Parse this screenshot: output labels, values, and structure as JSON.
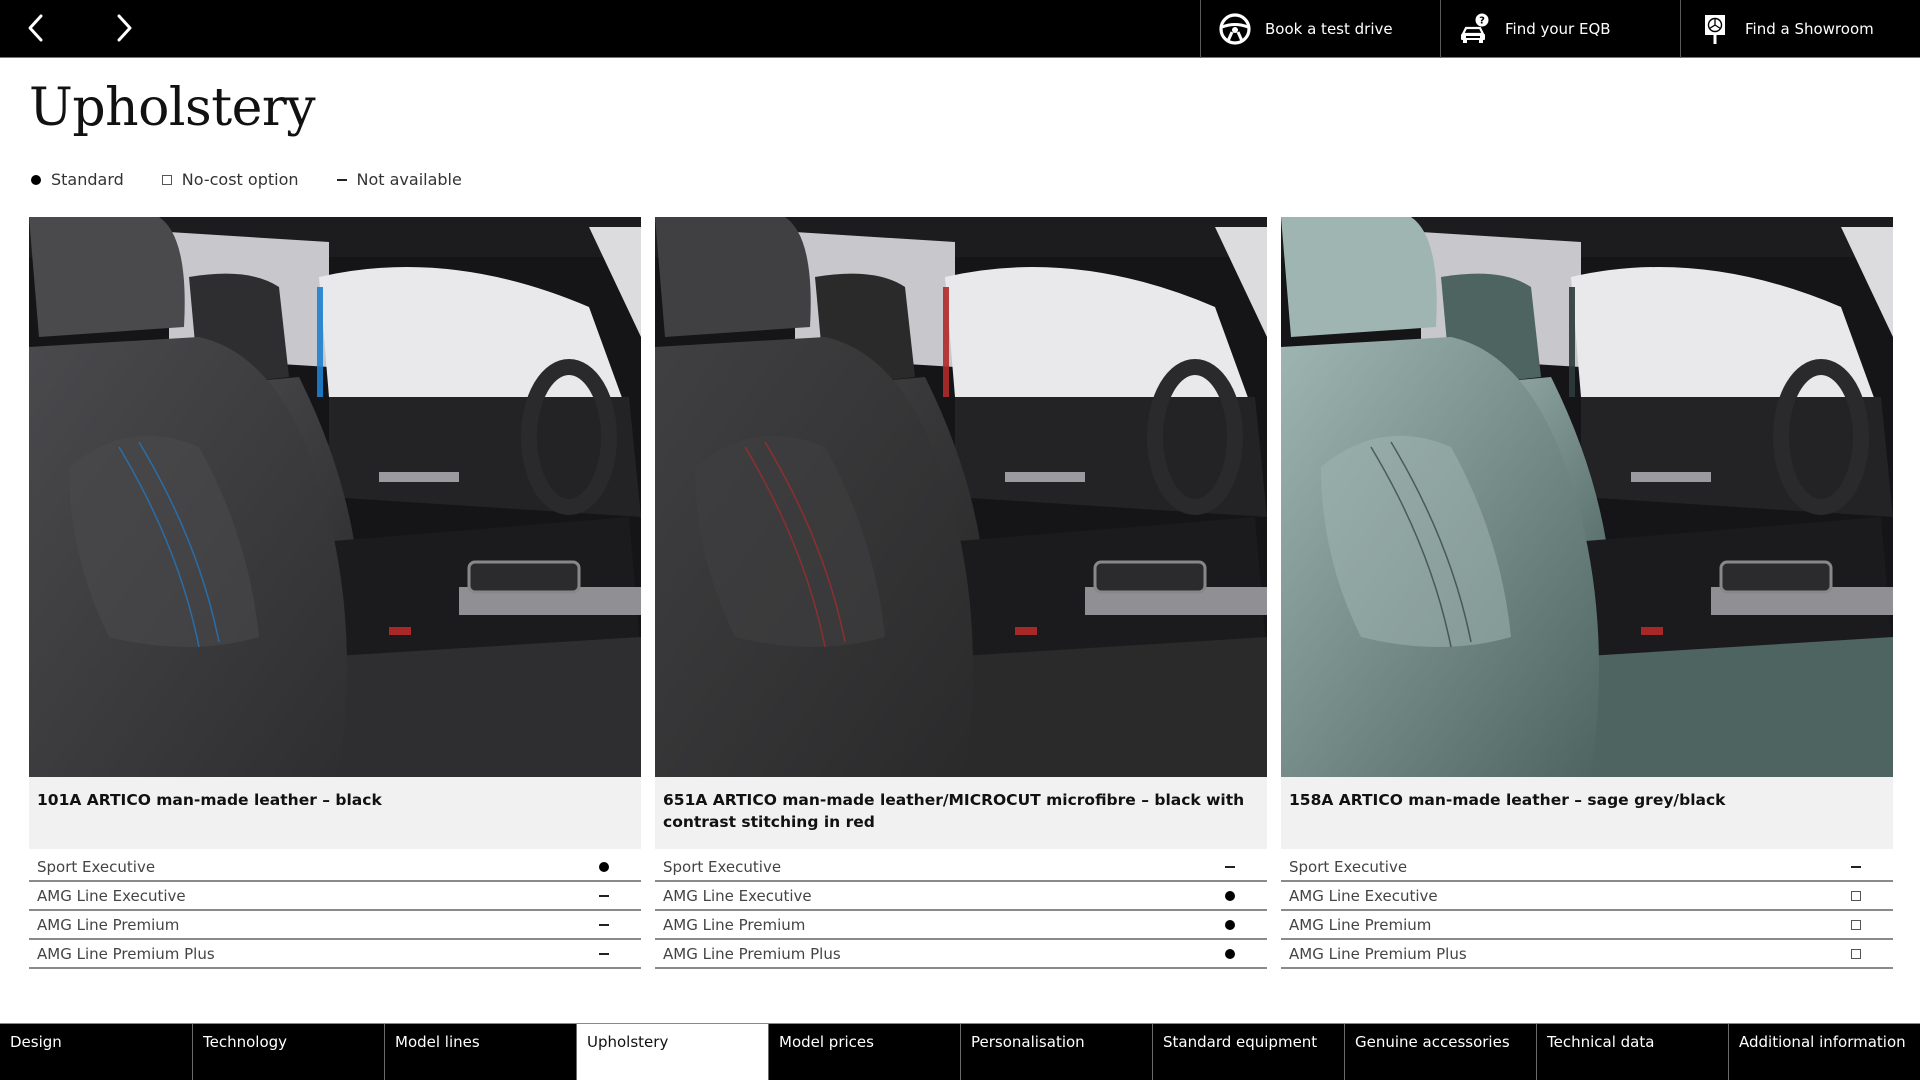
{
  "topbar": {
    "prev_label": "Previous page",
    "next_label": "Next page",
    "actions": [
      {
        "label": "Book a test drive",
        "icon": "steering-wheel-icon"
      },
      {
        "label": "Find your EQB",
        "icon": "car-question-icon"
      },
      {
        "label": "Find a Showroom",
        "icon": "showroom-sign-icon"
      }
    ]
  },
  "page": {
    "title": "Upholstery"
  },
  "legend": [
    {
      "symbol": "standard",
      "label": "Standard"
    },
    {
      "symbol": "no-cost",
      "label": "No-cost option"
    },
    {
      "symbol": "not-available",
      "label": "Not available"
    }
  ],
  "cards": [
    {
      "caption": "101A  ARTICO man-made leather – black",
      "colors": {
        "seat": "#2e2e30",
        "seat_light": "#4a4a4d",
        "accent": "#1e7fd0"
      },
      "rows": [
        {
          "label": "Sport Executive",
          "mark": "standard"
        },
        {
          "label": "AMG Line Executive",
          "mark": "not-available"
        },
        {
          "label": "AMG Line Premium",
          "mark": "not-available"
        },
        {
          "label": "AMG Line Premium Plus",
          "mark": "not-available"
        }
      ]
    },
    {
      "caption": "651A  ARTICO man-made leather/MICROCUT microfibre – black with contrast stitching in red",
      "colors": {
        "seat": "#2a2a2b",
        "seat_light": "#404042",
        "accent": "#b02a2a"
      },
      "rows": [
        {
          "label": "Sport Executive",
          "mark": "not-available"
        },
        {
          "label": "AMG Line Executive",
          "mark": "standard"
        },
        {
          "label": "AMG Line Premium",
          "mark": "standard"
        },
        {
          "label": "AMG Line Premium Plus",
          "mark": "standard"
        }
      ]
    },
    {
      "caption": "158A  ARTICO man-made leather – sage grey/black",
      "colors": {
        "seat": "#4d6461",
        "seat_light": "#9fb5b1",
        "accent": "#2c3b3a"
      },
      "rows": [
        {
          "label": "Sport Executive",
          "mark": "not-available"
        },
        {
          "label": "AMG Line Executive",
          "mark": "no-cost"
        },
        {
          "label": "AMG Line Premium",
          "mark": "no-cost"
        },
        {
          "label": "AMG Line Premium Plus",
          "mark": "no-cost"
        }
      ]
    }
  ],
  "bottom_tabs": {
    "active_index": 3,
    "items": [
      "Design",
      "Technology",
      "Model lines",
      "Upholstery",
      "Model prices",
      "Personalisation",
      "Standard equipment",
      "Genuine accessories",
      "Technical data",
      "Additional information"
    ]
  }
}
